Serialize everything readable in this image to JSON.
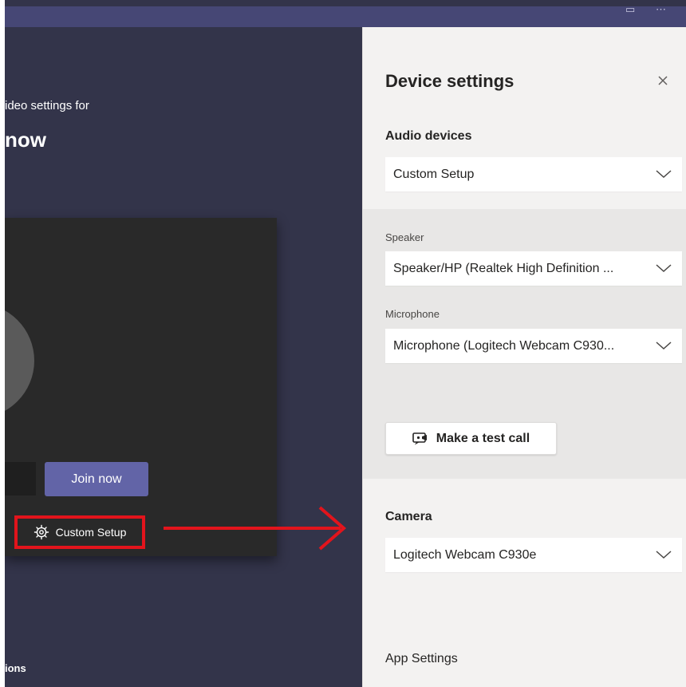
{
  "background": {
    "intro_text": "ideo settings for",
    "heading": "now",
    "join_label": "Join now",
    "custom_setup_label": "Custom Setup",
    "options_label": "ions"
  },
  "panel": {
    "title": "Device settings",
    "audio_devices_label": "Audio devices",
    "audio_devices_value": "Custom Setup",
    "speaker_label": "Speaker",
    "speaker_value": "Speaker/HP (Realtek High Definition ...",
    "microphone_label": "Microphone",
    "microphone_value": "Microphone (Logitech Webcam C930...",
    "test_call_label": "Make a test call",
    "camera_label": "Camera",
    "camera_value": "Logitech Webcam C930e",
    "app_settings_label": "App Settings"
  },
  "colors": {
    "stage_bg": "#33344a",
    "titlebar": "#464775",
    "accent_button": "#6264a7",
    "highlight_red": "#e2141c",
    "panel_bg": "#f3f2f1",
    "audio_sub_bg": "#e8e7e6"
  },
  "icons": {
    "close": "close-icon",
    "chevron": "chevron-down-icon",
    "gear": "gear-icon",
    "test_call": "test-call-icon",
    "arrow": "arrow-right-icon"
  }
}
